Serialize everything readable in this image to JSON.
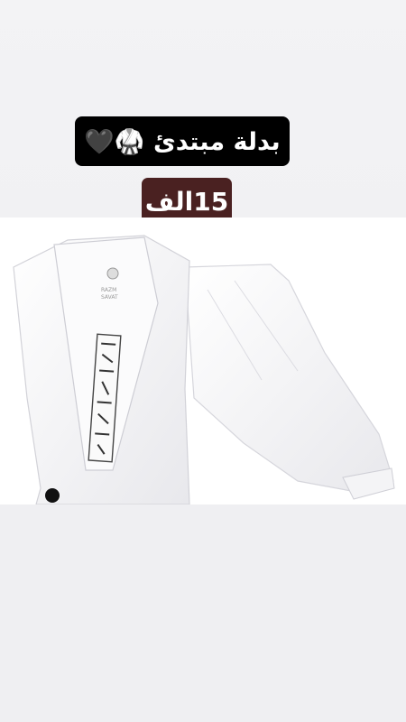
{
  "story": {
    "title": "بدلة مبتدئ 🥋🖤",
    "price": "15الف"
  },
  "photo": {
    "label_lines": [
      "RAZM",
      "SAVAT"
    ],
    "icon": "karate-uniform-icon",
    "accent_color": "#4a2121"
  }
}
